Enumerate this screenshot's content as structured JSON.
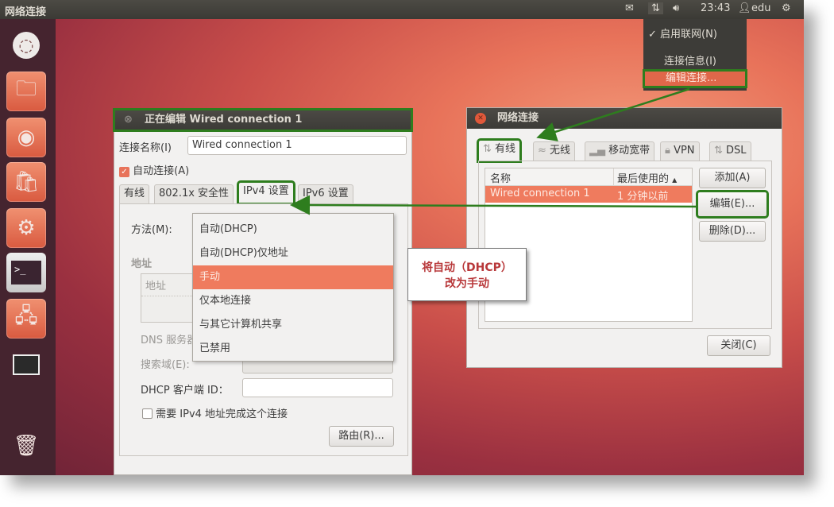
{
  "top_panel": {
    "app_title": "网络连接",
    "mail_icon": "mail-icon",
    "network_icon": "network-updown-icon",
    "volume_icon": "volume-icon",
    "time": "23:43",
    "user": "edu",
    "user_icon": "user-icon",
    "power_icon": "gear-power-icon"
  },
  "network_menu": {
    "items": [
      {
        "label": "启用联网(N)",
        "checked": true
      },
      {
        "label": "连接信息(I)"
      },
      {
        "label": "编辑连接...",
        "highlighted": true
      }
    ]
  },
  "launcher": {
    "items": [
      "dash-home",
      "files",
      "firefox",
      "software-center",
      "system-settings",
      "terminal",
      "network-workspace",
      "workspace-switcher",
      "trash"
    ]
  },
  "edit_window": {
    "title": "正在编辑 Wired connection 1",
    "connection_name_label": "连接名称(I)",
    "connection_name_value": "Wired connection 1",
    "auto_connect_label": "自动连接(A)",
    "auto_connect_checked": true,
    "tabs": [
      "有线",
      "802.1x 安全性",
      "IPv4 设置",
      "IPv6 设置"
    ],
    "active_tab": "IPv4 设置",
    "method_label": "方法(M):",
    "address_section": "地址",
    "address_column": "地址",
    "dns_label": "DNS 服务器",
    "search_domain_label": "搜索域(E):",
    "dhcp_client_id_label": "DHCP 客户端 ID：",
    "dhcp_client_id_value": "",
    "require_ipv4_label": "需要 IPv4 地址完成这个连接",
    "require_ipv4_checked": false,
    "routes_button": "路由(R)..."
  },
  "method_dropdown": {
    "options": [
      "自动(DHCP)",
      "自动(DHCP)仅地址",
      "手动",
      "仅本地连接",
      "与其它计算机共享",
      "已禁用"
    ],
    "selected": "手动"
  },
  "network_window": {
    "title": "网络连接",
    "tabs": [
      "有线",
      "无线",
      "移动宽带",
      "VPN",
      "DSL"
    ],
    "active_tab": "有线",
    "columns": [
      "名称",
      "最后使用的"
    ],
    "sort_indicator": "▲",
    "rows": [
      {
        "name": "Wired connection 1",
        "last_used": "1 分钟以前",
        "selected": true
      }
    ],
    "buttons": {
      "add": "添加(A)",
      "edit": "编辑(E)...",
      "delete": "删除(D)...",
      "close": "关闭(C)"
    }
  },
  "callout": {
    "line1": "将自动（DHCP）",
    "line2": "改为手动"
  },
  "colors": {
    "accent": "#ef7b5e",
    "annotation_green": "#2e7d1e",
    "callout_text": "#b8383a",
    "panel": "#3c3b37",
    "launcher": "#45242f"
  }
}
